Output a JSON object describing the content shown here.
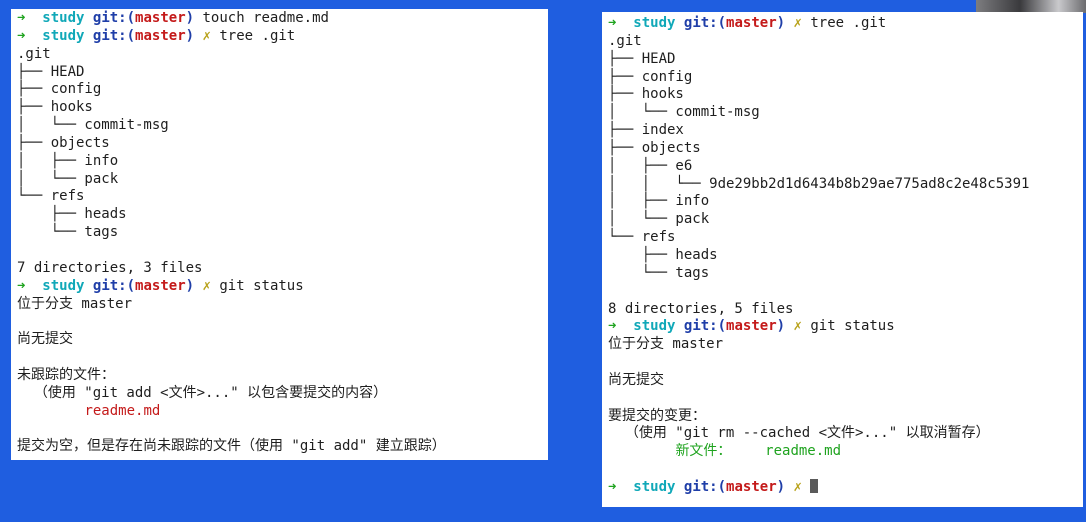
{
  "prompt": {
    "arrow": "➜",
    "user": "study",
    "git": "git:(",
    "branch": "master",
    "git_close": ")",
    "dirty": "✗"
  },
  "left": {
    "cmd1": "touch readme.md",
    "cmd2": "tree .git",
    "tree": [
      ".git",
      "├── HEAD",
      "├── config",
      "├── hooks",
      "│   └── commit-msg",
      "├── objects",
      "│   ├── info",
      "│   └── pack",
      "└── refs",
      "    ├── heads",
      "    └── tags"
    ],
    "summary": "7 directories, 3 files",
    "cmd3": "git status",
    "status": {
      "on_branch": "位于分支 master",
      "no_commits": "尚无提交",
      "untracked_header": "未跟踪的文件：",
      "untracked_hint": "  （使用 \"git add <文件>...\" 以包含要提交的内容）",
      "untracked_file": "readme.md",
      "footer": "提交为空，但是存在尚未跟踪的文件（使用 \"git add\" 建立跟踪）"
    }
  },
  "right": {
    "cmd1": "tree .git",
    "tree": [
      ".git",
      "├── HEAD",
      "├── config",
      "├── hooks",
      "│   └── commit-msg",
      "├── index",
      "├── objects",
      "│   ├── e6",
      "│   │   └── 9de29bb2d1d6434b8b29ae775ad8c2e48c5391",
      "│   ├── info",
      "│   └── pack",
      "└── refs",
      "    ├── heads",
      "    └── tags"
    ],
    "summary": "8 directories, 5 files",
    "cmd2": "git status",
    "status": {
      "on_branch": "位于分支 master",
      "no_commits": "尚无提交",
      "staged_header": "要提交的变更：",
      "staged_hint": "  （使用 \"git rm --cached <文件>...\" 以取消暂存）",
      "new_file_label": "新文件：",
      "new_file": "readme.md"
    }
  },
  "colors": {
    "background": "#1f5ee0",
    "terminal_bg": "#ffffff",
    "arrow": "#1fa31f",
    "user": "#10a8b8",
    "git_label": "#1f3ea8",
    "branch": "#c41a1a",
    "dirty": "#b8a21a",
    "untracked": "#c41a1a",
    "staged": "#1fa31f"
  }
}
